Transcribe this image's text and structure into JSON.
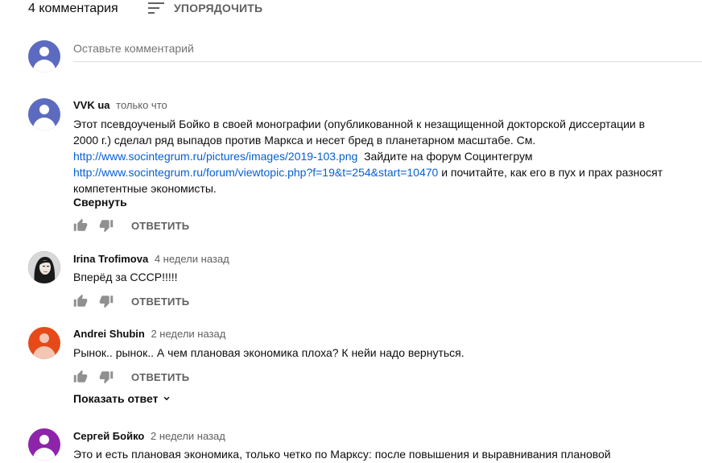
{
  "header": {
    "count_label": "4 комментария",
    "sort_label": "УПОРЯДОЧИТЬ"
  },
  "new_comment": {
    "placeholder": "Оставьте комментарий",
    "avatar_color": "#5c6bc0"
  },
  "comments": [
    {
      "author": "VVK ua",
      "time": "только что",
      "avatar_color": "#5c6bc0",
      "lines": [
        "Этот псевдоученый Бойко в своей монографии (опубликованной к незащищенной докторской диссертации в",
        "2000 г.) сделал ряд выпадов против Маркса и несет бред в планетарном масштабе. См."
      ],
      "link1": "http://www.socintegrum.ru/pictures/images/2019-103.png",
      "after_link1": "  Зайдите на форум Социнтегрум",
      "link2": "http://www.socintegrum.ru/forum/viewtopic.php?f=19&t=254&start=10470",
      "after_link2": " и почитайте, как его в пух и прах разносят",
      "last_line": "компетентные экономисты.",
      "collapse_label": "Свернуть",
      "reply_label": "ОТВЕТИТЬ"
    },
    {
      "author": "Irina Trofimova",
      "time": "4 недели назад",
      "avatar_color": "#2b2b2b",
      "text": "Вперёд за СССР!!!!!",
      "reply_label": "ОТВЕТИТЬ"
    },
    {
      "author": "Andrei Shubin",
      "time": "2 недели назад",
      "avatar_color": "#e64a19",
      "text": "Рынок.. рынок.. А чем плановая экономика плоха? К нейи надо вернуться.",
      "reply_label": "ОТВЕТИТЬ",
      "show_replies_label": "Показать ответ"
    },
    {
      "author": "Сергей Бойко",
      "time": "2 недели назад",
      "avatar_color": "#8e24aa",
      "text": "Это и есть плановая экономика, только четко по Марксу: после повышения и выравнивания плановой"
    }
  ],
  "icons": {
    "sort": "sort-icon",
    "like": "thumbs-up-icon",
    "dislike": "thumbs-down-icon",
    "chevron": "chevron-down-icon"
  }
}
